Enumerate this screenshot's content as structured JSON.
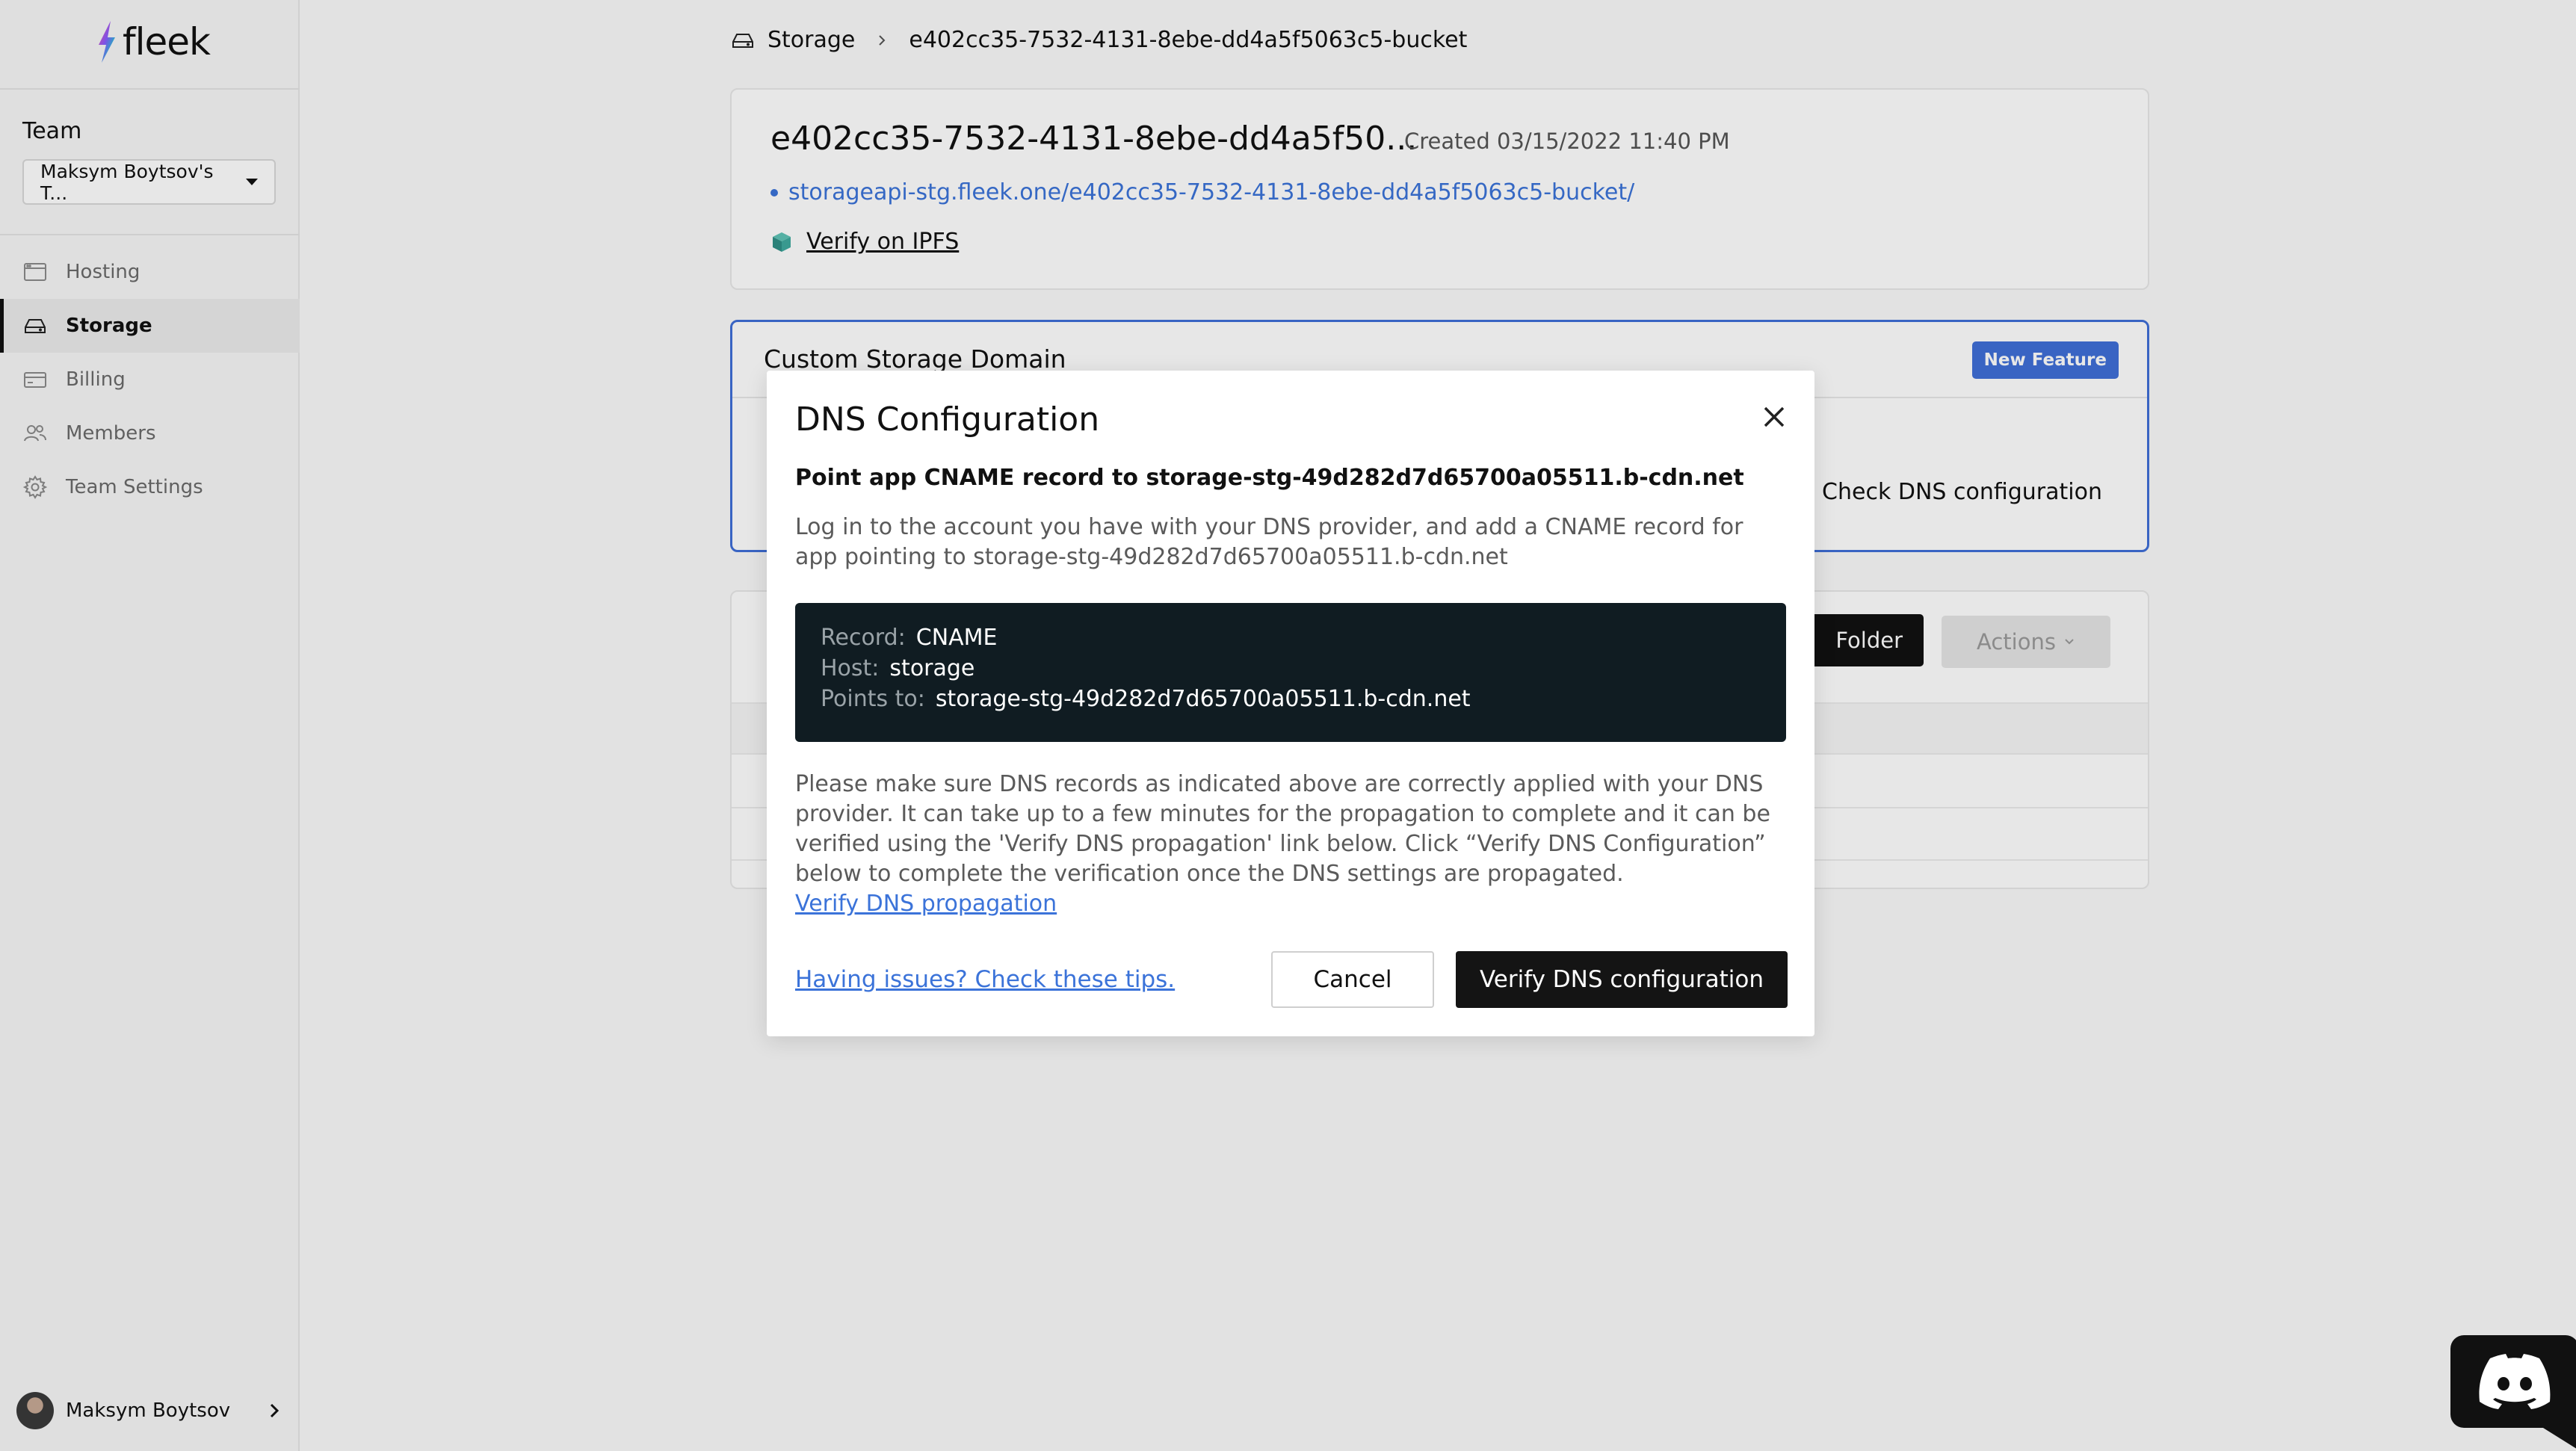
{
  "app": {
    "logo_text": "fleek",
    "icons": {
      "logo": "lightning-bolt-icon",
      "hosting": "browser-window-icon",
      "storage": "hard-drive-icon",
      "billing": "credit-card-icon",
      "members": "users-icon",
      "team_settings": "gear-icon",
      "ipfs": "cube-icon",
      "close": "close-icon",
      "discord": "discord-icon"
    },
    "colors": {
      "accent": "#3f6fd8",
      "link": "#3b73d9",
      "record_box": "#101c22",
      "primary_button": "#141414"
    }
  },
  "sidebar": {
    "team_label": "Team",
    "team_select_value": "Maksym Boytsov's T...",
    "items": [
      {
        "label": "Hosting",
        "active": false
      },
      {
        "label": "Storage",
        "active": true
      },
      {
        "label": "Billing",
        "active": false
      },
      {
        "label": "Members",
        "active": false
      },
      {
        "label": "Team Settings",
        "active": false
      }
    ],
    "user_name": "Maksym Boytsov"
  },
  "breadcrumb": {
    "root": "Storage",
    "current": "e402cc35-7532-4131-8ebe-dd4a5f5063c5-bucket"
  },
  "bucket": {
    "title": "e402cc35-7532-4131-8ebe-dd4a5f50...",
    "created": "Created 03/15/2022 11:40 PM",
    "url": "storageapi-stg.fleek.one/e402cc35-7532-4131-8ebe-dd4a5f5063c5-bucket/",
    "verify_ipfs": "Verify on IPFS"
  },
  "custom_domain": {
    "title": "Custom Storage Domain",
    "badge": "New Feature",
    "check_dns": "Check DNS configuration"
  },
  "files": {
    "folder_button": "Folder",
    "actions_button": "Actions"
  },
  "modal": {
    "title": "DNS Configuration",
    "subtitle": "Point app CNAME record to storage-stg-49d282d7d65700a05511.b-cdn.net",
    "description": "Log in to the account you have with your DNS provider, and add a CNAME record for app pointing to storage-stg-49d282d7d65700a05511.b-cdn.net",
    "record": {
      "record_key": "Record:",
      "record_value": "CNAME",
      "host_key": "Host:",
      "host_value": "storage",
      "points_key": "Points to:",
      "points_value": "storage-stg-49d282d7d65700a05511.b-cdn.net"
    },
    "note": "Please make sure DNS records as indicated above are correctly applied with your DNS provider. It can take up to a few minutes for the propagation to complete and it can be verified using the 'Verify DNS propagation' link below. Click “Verify DNS Configuration” below to complete the verification once the DNS settings are propagated.",
    "verify_propagation_link": "Verify DNS propagation",
    "tips_link": "Having issues? Check these tips.",
    "cancel_button": "Cancel",
    "verify_button": "Verify DNS configuration"
  }
}
